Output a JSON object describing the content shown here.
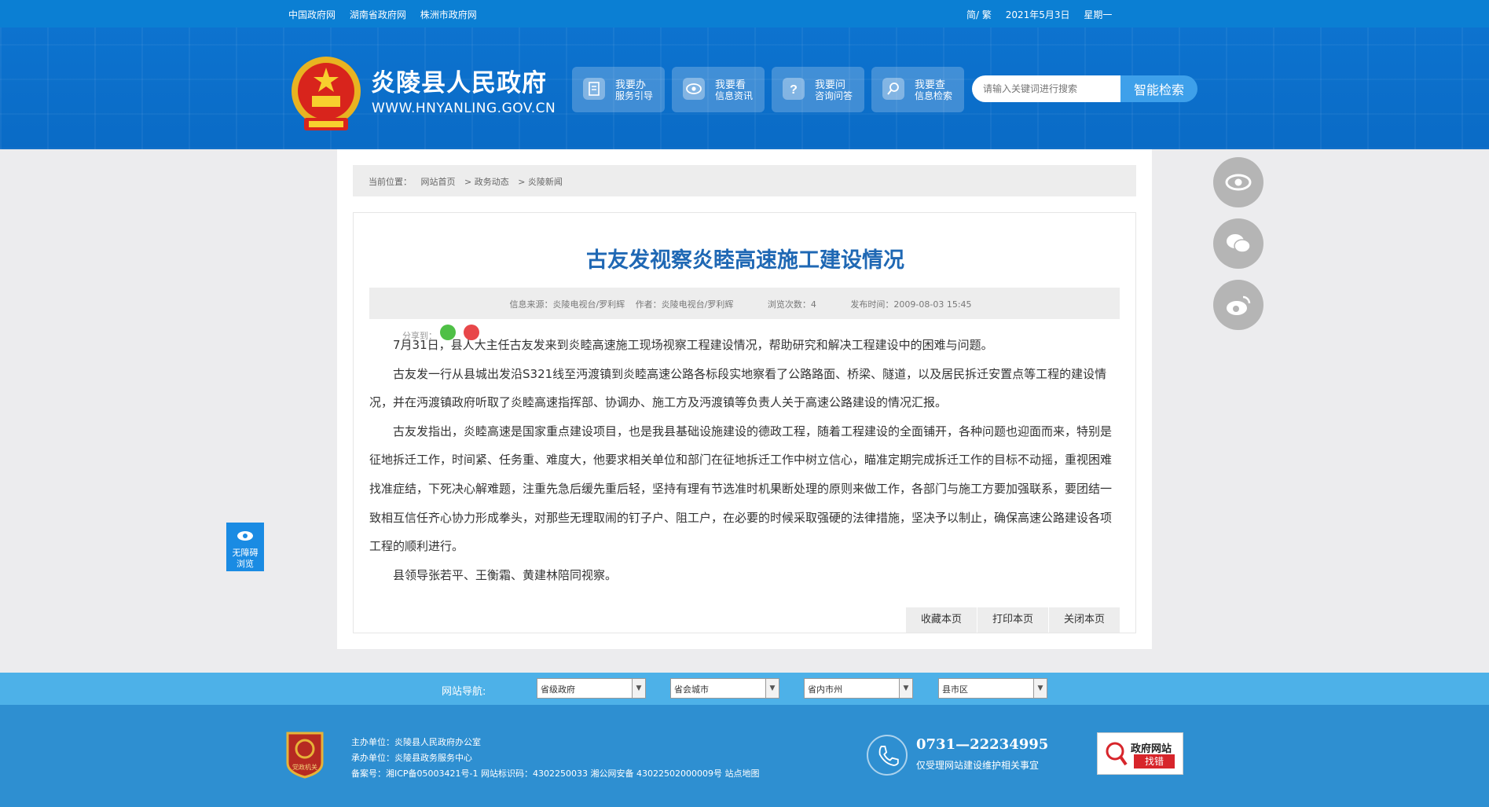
{
  "topbar": {
    "links": [
      "中国政府网",
      "湖南省政府网",
      "株洲市政府网"
    ],
    "lang_switch": "简/ 繁",
    "date": "2021年5月3日",
    "weekday": "星期一"
  },
  "header": {
    "site_name": "炎陵县人民政府",
    "site_url": "WWW.HNYANLING.GOV.CN",
    "buttons": [
      {
        "line1": "我要办",
        "line2": "服务引导",
        "icon": "document-icon"
      },
      {
        "line1": "我要看",
        "line2": "信息资讯",
        "icon": "eye-icon"
      },
      {
        "line1": "我要问",
        "line2": "咨询问答",
        "icon": "question-icon"
      },
      {
        "line1": "我要查",
        "line2": "信息检索",
        "icon": "search-icon"
      }
    ],
    "search_placeholder": "请输入关键词进行搜索",
    "search_button": "智能检索"
  },
  "breadcrumb": {
    "label": "当前位置：",
    "items": [
      "网站首页",
      "> 政务动态",
      "> 炎陵新闻"
    ]
  },
  "article": {
    "title": "古友发视察炎睦高速施工建设情况",
    "meta": {
      "source": "信息来源：炎陵电视台/罗利辉",
      "author": "作者：炎陵电视台/罗利辉",
      "views": "浏览次数：4",
      "published": "发布时间：2009-08-03 15:45"
    },
    "share_label": "分享到：",
    "paragraphs": [
      "7月31日，县人大主任古友发来到炎睦高速施工现场视察工程建设情况，帮助研究和解决工程建设中的困难与问题。",
      "古友发一行从县城出发沿S321线至沔渡镇到炎睦高速公路各标段实地察看了公路路面、桥梁、隧道，以及居民拆迁安置点等工程的建设情况，并在沔渡镇政府听取了炎睦高速指挥部、协调办、施工方及沔渡镇等负责人关于高速公路建设的情况汇报。",
      "古友发指出，炎睦高速是国家重点建设项目，也是我县基础设施建设的德政工程，随着工程建设的全面铺开，各种问题也迎面而来，特别是征地拆迁工作，时间紧、任务重、难度大，他要求相关单位和部门在征地拆迁工作中树立信心，瞄准定期完成拆迁工作的目标不动摇，重视困难找准症结，下死决心解难题，注重先急后缓先重后轻，坚持有理有节选准时机果断处理的原则来做工作，各部门与施工方要加强联系，要团结一致相互信任齐心协力形成拳头，对那些无理取闹的钉子户、阻工户，在必要的时候采取强硬的法律措施，坚决予以制止，确保高速公路建设各项工程的顺利进行。",
      "县领导张若平、王衡霜、黄建林陪同视察。"
    ],
    "actions": [
      "收藏本页",
      "打印本页",
      "关闭本页"
    ]
  },
  "accessibility": {
    "line1": "无障碍",
    "line2": "浏览"
  },
  "site_nav": {
    "label": "网站导航:",
    "selects": [
      "省级政府",
      "省会城市",
      "省内市州",
      "县市区"
    ]
  },
  "footer": {
    "host": "主办单位：炎陵县人民政府办公室",
    "operator": "承办单位：炎陵县政务服务中心",
    "record": "备案号：湘ICP备05003421号-1 网站标识码：4302250033 湘公网安备 43022502000009号 站点地图",
    "badge_text": "党政机关",
    "phone": "0731—22234995",
    "phone_note": "仅受理网站建设维护相关事宜",
    "error_line1": "政府网站",
    "error_line2": "找错"
  },
  "colors": {
    "topbar": "#0b7fd3",
    "header": "#0d73cf",
    "title": "#1f68b4",
    "nav_strip": "#4db1e8",
    "footer": "#2e8fd1"
  }
}
